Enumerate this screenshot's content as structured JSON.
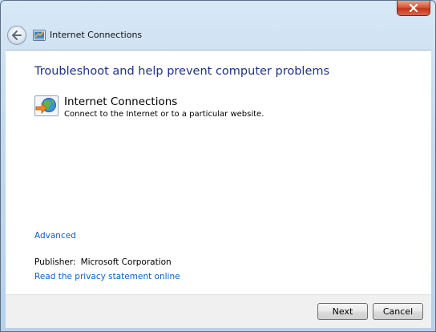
{
  "window": {
    "nav_title": "Internet Connections",
    "accent_color": "#1e3287",
    "link_color": "#0b5fc2"
  },
  "main": {
    "heading": "Troubleshoot and help prevent computer problems",
    "task": {
      "icon": "network-troubleshooter-icon",
      "title": "Internet Connections",
      "description": "Connect to the Internet or to a particular website."
    },
    "advanced_link": "Advanced",
    "publisher_label": "Publisher:",
    "publisher_value": "Microsoft Corporation",
    "privacy_link": "Read the privacy statement online"
  },
  "footer": {
    "next_label": "Next",
    "cancel_label": "Cancel"
  },
  "icons": {
    "close": "close-icon",
    "back": "back-arrow-icon"
  }
}
